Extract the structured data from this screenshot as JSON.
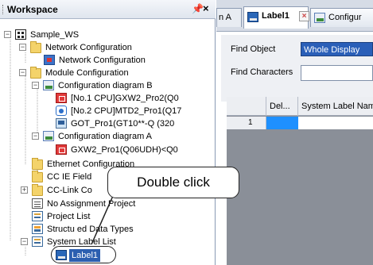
{
  "workspace": {
    "title": "Workspace",
    "pin_glyph": "\u0004",
    "close_glyph": "×",
    "tree": [
      {
        "id": "sample_ws",
        "label": "Sample_WS",
        "icon": "workspace-icon"
      },
      {
        "id": "net_conf_folder",
        "label": "Network Configuration",
        "icon": "folder-icon"
      },
      {
        "id": "net_conf",
        "label": "Network Configuration",
        "icon": "network-configuration-icon"
      },
      {
        "id": "mod_conf",
        "label": "Module Configuration",
        "icon": "folder-icon"
      },
      {
        "id": "conf_b",
        "label": "Configuration diagram B",
        "icon": "configuration-diagram-icon"
      },
      {
        "id": "cpu1",
        "label": "[No.1 CPU]GXW2_Pro2(Q0",
        "icon": "cpu-module-icon"
      },
      {
        "id": "cpu2",
        "label": "[No.2 CPU]MTD2_Pro1(Q17",
        "icon": "motion-cpu-icon"
      },
      {
        "id": "got",
        "label": "GOT_Pro1(GT10**-Q (320",
        "icon": "got-icon"
      },
      {
        "id": "conf_a",
        "label": "Configuration diagram A",
        "icon": "configuration-diagram-icon"
      },
      {
        "id": "gxw2",
        "label": "GXW2_Pro1(Q06UDH)<Q0",
        "icon": "cpu-module-icon"
      },
      {
        "id": "ethernet",
        "label": "Ethernet Configuration",
        "icon": "folder-icon"
      },
      {
        "id": "ccie",
        "label": "CC IE Field Configuration",
        "icon": "folder-icon"
      },
      {
        "id": "cclink",
        "label": "CC-Link Configuration",
        "icon": "folder-icon"
      },
      {
        "id": "noassign",
        "label": "No Assignment Project",
        "icon": "project-icon"
      },
      {
        "id": "projlist",
        "label": "Project List",
        "icon": "project-list-icon"
      },
      {
        "id": "struct",
        "label": "Structured Data Types",
        "icon": "structured-data-types-icon"
      },
      {
        "id": "syslabel",
        "label": "System Label List",
        "icon": "system-label-list-icon"
      },
      {
        "id": "label1",
        "label": "Label1",
        "icon": "label-icon"
      }
    ],
    "visible_labels": {
      "sample_ws": "Sample_WS",
      "net_conf_folder": "Network Configuration",
      "net_conf": "Network Configuration",
      "mod_conf": "Module Configuration",
      "conf_b": "Configuration diagram B",
      "cpu1": "[No.1 CPU]GXW2_Pro2(Q0",
      "cpu2": "[No.2 CPU]MTD2_Pro1(Q17",
      "got": "GOT_Pro1(GT10**-Q (320",
      "conf_a": "Configuration diagram A",
      "gxw2": "GXW2_Pro1(Q06UDH)<Q0",
      "ethernet": "Ethernet Configuration",
      "ccie": "CC IE Field",
      "cclink": "CC-Link Co",
      "noassign": "No Assignment Project",
      "projlist": "Project List",
      "struct": "Structu  ed Data Types",
      "syslabel": "System Label List",
      "label1": "Label1"
    }
  },
  "callout": {
    "text": "Double click"
  },
  "tabs": {
    "prev": "n A",
    "label1": "Label1",
    "config": "Configur",
    "close_glyph": "×"
  },
  "find": {
    "object_label": "Find Object",
    "object_value": "Whole Display",
    "characters_label": "Find Characters",
    "characters_value": ""
  },
  "grid": {
    "columns": [
      "",
      "Del...",
      "System Label Nam"
    ],
    "rows": [
      {
        "num": "1",
        "del": "",
        "name": ""
      }
    ]
  }
}
